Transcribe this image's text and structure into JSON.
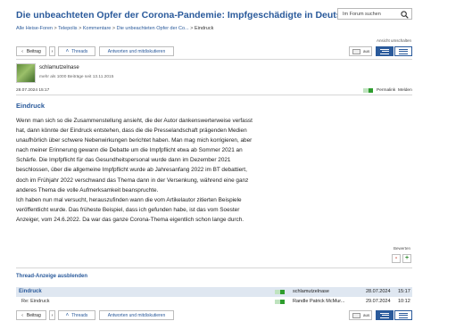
{
  "page": {
    "title": "Die unbeachteten Opfer der Corona-Pandemie: Impfgeschädigte in Deutschland",
    "search_placeholder": "Im Forum suchen"
  },
  "breadcrumb": {
    "items": [
      "Alle Heise-Foren",
      "Telepolis",
      "Kommentare",
      "Die unbeachteten Opfer der Co..."
    ],
    "separator": ">",
    "current": "Eindruck"
  },
  "toolbar": {
    "prev_label": "Beitrag",
    "threads_label": "Threads",
    "reply_label": "Antworten und mitdiskutieren",
    "view_label": "Ansicht umschalten",
    "toggle_label": "aus"
  },
  "post": {
    "author": "schlamutzelnase",
    "author_meta": "mehr als 1000 Beiträge seit 13.11.2015",
    "date": "28.07.2024 15:17",
    "permalink_label": "Permalink",
    "report_label": "Melden",
    "title": "Eindruck",
    "body_lines": [
      "Wenn man sich so die Zusammenstellung ansieht, die der Autor dankenswerterweise verfasst",
      "hat, dann könnte der Eindruck entstehen, dass die die Presselandschaft prägenden Medien",
      "unaufhörlich über schwere Nebenwirkungen berichtet haben. Man mag mich korrigieren, aber",
      "nach meiner Erinnerung gewann die Debatte um die Impfpflicht etwa ab Sommer 2021 an",
      "Schärfe. Die Impfpflicht für das Gesundheitspersonal wurde dann im Dezember 2021",
      "beschlossen, über die allgemeine Impfpflicht wurde ab Jahresanfang 2022 im BT debattiert,",
      "doch im Frühjahr 2022 verschwand das Thema dann in der Versenkung, während eine ganz",
      "anderes Thema die volle Aufmerksamkeit beanspruchte.",
      "Ich haben nun mal versucht, herauszufinden wann die vom Artikelautor zitierten Beispiele",
      "veröffentlicht wurde. Das früheste Beispiel, dass ich gefunden habe, ist das vom Soester",
      "Anzeiger, vom 24.6.2022. Da war das ganze Corona-Thema eigentlich schon lange durch."
    ],
    "rate_label": "Bewerten",
    "vote_minus": "-",
    "vote_plus": "+"
  },
  "thread": {
    "hide_label": "Thread-Anzeige ausblenden",
    "rows": [
      {
        "title": "Eindruck",
        "author": "schlamutzelnase",
        "date": "28.07.2024",
        "time": "15:17"
      },
      {
        "title": "Re: Eindruck",
        "author": "Randle Patrick McMur...",
        "date": "29.07.2024",
        "time": "10:12"
      }
    ]
  },
  "colors": {
    "link": "#2a5a9b",
    "rating_green": "#2e9d2e",
    "rating_light": "#bfe3bf",
    "highlight_row": "#dfe7f1"
  }
}
